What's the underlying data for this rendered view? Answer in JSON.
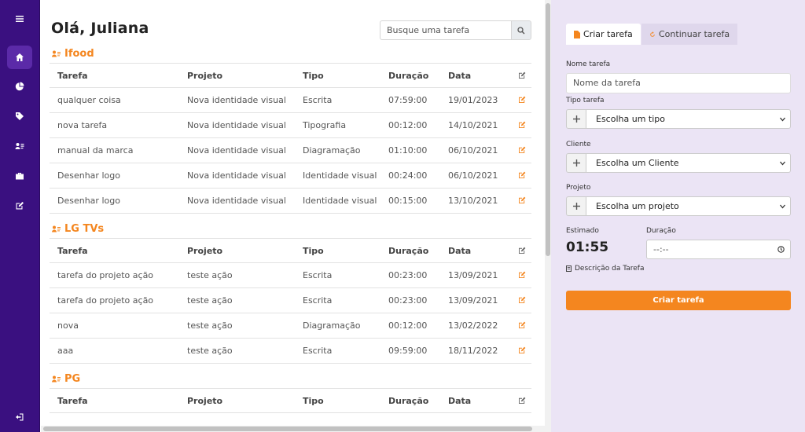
{
  "header": {
    "greeting": "Olá, Juliana"
  },
  "search": {
    "placeholder": "Busque uma tarefa"
  },
  "table_headers": {
    "task": "Tarefa",
    "project": "Projeto",
    "type": "Tipo",
    "duration": "Duração",
    "date": "Data"
  },
  "groups": [
    {
      "client": "Ifood",
      "rows": [
        {
          "task": "qualquer coisa",
          "project": "Nova identidade visual",
          "type": "Escrita",
          "duration": "07:59:00",
          "date": "19/01/2023"
        },
        {
          "task": "nova tarefa",
          "project": "Nova identidade visual",
          "type": "Tipografia",
          "duration": "00:12:00",
          "date": "14/10/2021"
        },
        {
          "task": "manual da marca",
          "project": "Nova identidade visual",
          "type": "Diagramação",
          "duration": "01:10:00",
          "date": "06/10/2021"
        },
        {
          "task": "Desenhar logo",
          "project": "Nova identidade visual",
          "type": "Identidade visual",
          "duration": "00:24:00",
          "date": "06/10/2021"
        },
        {
          "task": "Desenhar logo",
          "project": "Nova identidade visual",
          "type": "Identidade visual",
          "duration": "00:15:00",
          "date": "13/10/2021"
        }
      ]
    },
    {
      "client": "LG TVs",
      "rows": [
        {
          "task": "tarefa do projeto ação",
          "project": "teste ação",
          "type": "Escrita",
          "duration": "00:23:00",
          "date": "13/09/2021"
        },
        {
          "task": "tarefa do projeto ação",
          "project": "teste ação",
          "type": "Escrita",
          "duration": "00:23:00",
          "date": "13/09/2021"
        },
        {
          "task": "nova",
          "project": "teste ação",
          "type": "Diagramação",
          "duration": "00:12:00",
          "date": "13/02/2022"
        },
        {
          "task": "aaa",
          "project": "teste ação",
          "type": "Escrita",
          "duration": "09:59:00",
          "date": "18/11/2022"
        }
      ]
    },
    {
      "client": "PG",
      "rows": []
    }
  ],
  "panel": {
    "tab_create": "Criar tarefa",
    "tab_continue": "Continuar tarefa",
    "name_label": "Nome tarefa",
    "name_placeholder": "Nome da tarefa",
    "type_label": "Tipo tarefa",
    "type_select": "Escolha um tipo",
    "client_label": "Cliente",
    "client_select": "Escolha um Cliente",
    "project_label": "Projeto",
    "project_select": "Escolha um projeto",
    "estimated_label": "Estimado",
    "estimated_value": "01:55",
    "duration_label": "Duração",
    "duration_value": "--:--",
    "description_link": "Descrição da Tarefa",
    "submit": "Criar tarefa"
  },
  "colors": {
    "sidebar": "#3a1080",
    "accent": "#f4861f",
    "panel_bg": "#ebe4f5"
  },
  "icons": [
    "menu-icon",
    "home-icon",
    "pie-chart-icon",
    "tag-icon",
    "user-list-icon",
    "briefcase-icon",
    "edit-square-icon",
    "logout-icon",
    "search-icon",
    "users-icon",
    "edit-icon",
    "plus-icon",
    "chevron-down-icon",
    "clock-icon",
    "document-icon",
    "refresh-icon"
  ]
}
